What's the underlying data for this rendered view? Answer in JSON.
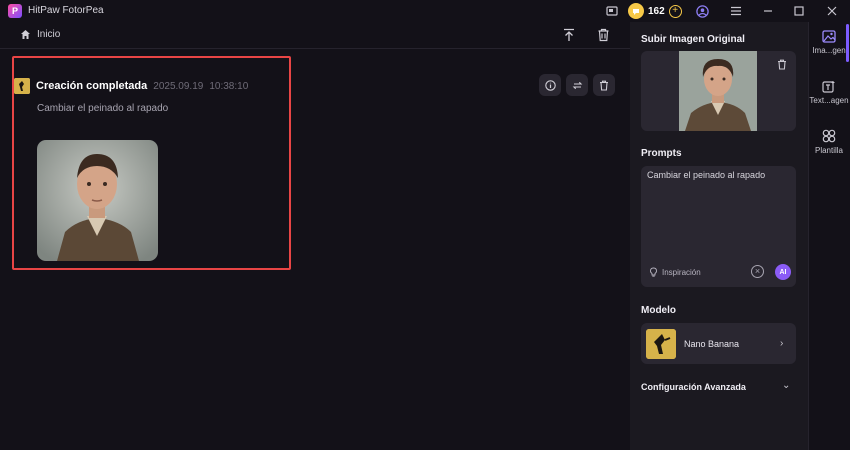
{
  "app": {
    "title": "HitPaw FotorPea",
    "credits": "162"
  },
  "nav": {
    "home_label": "Inicio"
  },
  "task": {
    "title": "Creación completada",
    "date": "2025.09.19",
    "time": "10:38:10",
    "prompt": "Cambiar el peinado al rapado"
  },
  "panel": {
    "upload_title": "Subir Imagen Original",
    "prompts_title": "Prompts",
    "prompt_value": "Cambiar el peinado al rapado",
    "inspiration_label": "Inspiración",
    "ai_label": "AI",
    "model_title": "Modelo",
    "model_name": "Nano Banana",
    "advanced_title": "Configuración Avanzada"
  },
  "rail": {
    "items": [
      {
        "label": "Ima...gen",
        "icon": "image-icon"
      },
      {
        "label": "Text...agen",
        "icon": "text-to-image-icon"
      },
      {
        "label": "Plantilla",
        "icon": "template-icon"
      }
    ]
  },
  "colors": {
    "accent": "#8b5cf6",
    "highlight_border": "#e84545",
    "coin": "#f7c948"
  }
}
